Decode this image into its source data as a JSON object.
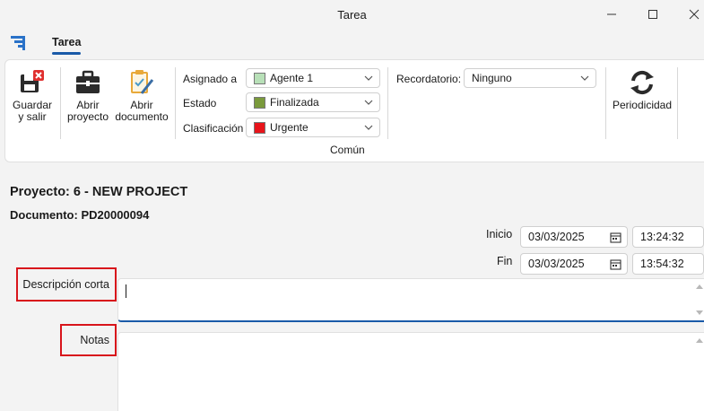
{
  "window": {
    "title": "Tarea"
  },
  "ribbon": {
    "tab": "Tarea",
    "buttons": {
      "save_close": {
        "line1": "Guardar",
        "line2": "y salir"
      },
      "open_project": {
        "line1": "Abrir",
        "line2": "proyecto"
      },
      "open_document": {
        "line1": "Abrir",
        "line2": "documento"
      },
      "periodicity": "Periodicidad"
    },
    "fields": {
      "assigned": {
        "label": "Asignado a",
        "value": "Agente 1",
        "color": "#b8e0b8"
      },
      "state": {
        "label": "Estado",
        "value": "Finalizada",
        "color": "#7a9a3c"
      },
      "classification": {
        "label": "Clasificación",
        "value": "Urgente",
        "color": "#e8141b"
      },
      "reminder": {
        "label": "Recordatorio:",
        "value": "Ninguno"
      }
    },
    "group_label": "Común"
  },
  "header": {
    "project": "Proyecto: 6 - NEW PROJECT",
    "document": "Documento: PD20000094"
  },
  "form": {
    "start": {
      "label": "Inicio",
      "date": "03/03/2025",
      "time": "13:24:32"
    },
    "end": {
      "label": "Fin",
      "date": "03/03/2025",
      "time": "13:54:32"
    },
    "short_description": {
      "label": "Descripción corta",
      "value": ""
    },
    "notes": {
      "label": "Notas",
      "value": ""
    }
  },
  "colors": {
    "accent": "#1a5aa8",
    "highlight": "#d8141b"
  }
}
